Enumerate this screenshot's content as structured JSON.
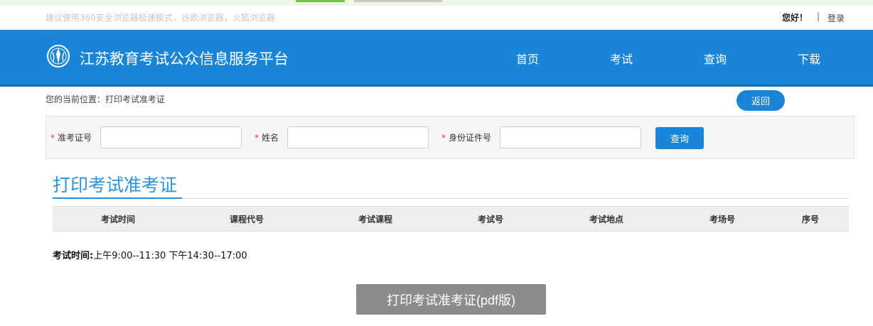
{
  "topbar": {
    "browser_tip": "建议使用360安全浏览器极速模式，谷歌浏览器，火狐浏览器",
    "greeting": "您好！",
    "separator": "|",
    "login": "登录"
  },
  "header": {
    "site_title": "江苏教育考试公众信息服务平台",
    "logo_icon": "emblem-icon",
    "nav": [
      "首页",
      "考试",
      "查询",
      "下载"
    ]
  },
  "breadcrumb": "您的当前位置：打印考试准考证",
  "back_button": "返回",
  "search": {
    "required_mark": "*",
    "fields": [
      {
        "label": "准考证号",
        "value": ""
      },
      {
        "label": "姓名",
        "value": ""
      },
      {
        "label": "身份证件号",
        "value": ""
      }
    ],
    "query_button": "查询"
  },
  "section_title": "打印考试准考证",
  "table": {
    "columns": [
      "考试时间",
      "课程代号",
      "考试课程",
      "考试号",
      "考试地点",
      "考场号",
      "序号"
    ],
    "rows": []
  },
  "exam_time": {
    "label": "考试时间:",
    "value": "上午9:00--11:30 下午14:30--17:00"
  },
  "print_button": "打印考试准考证(pdf版)",
  "colors": {
    "header_bg": "#1a84d6",
    "accent": "#2b93dc",
    "required": "#ee3333",
    "print_button_bg": "#8c8c8c"
  }
}
